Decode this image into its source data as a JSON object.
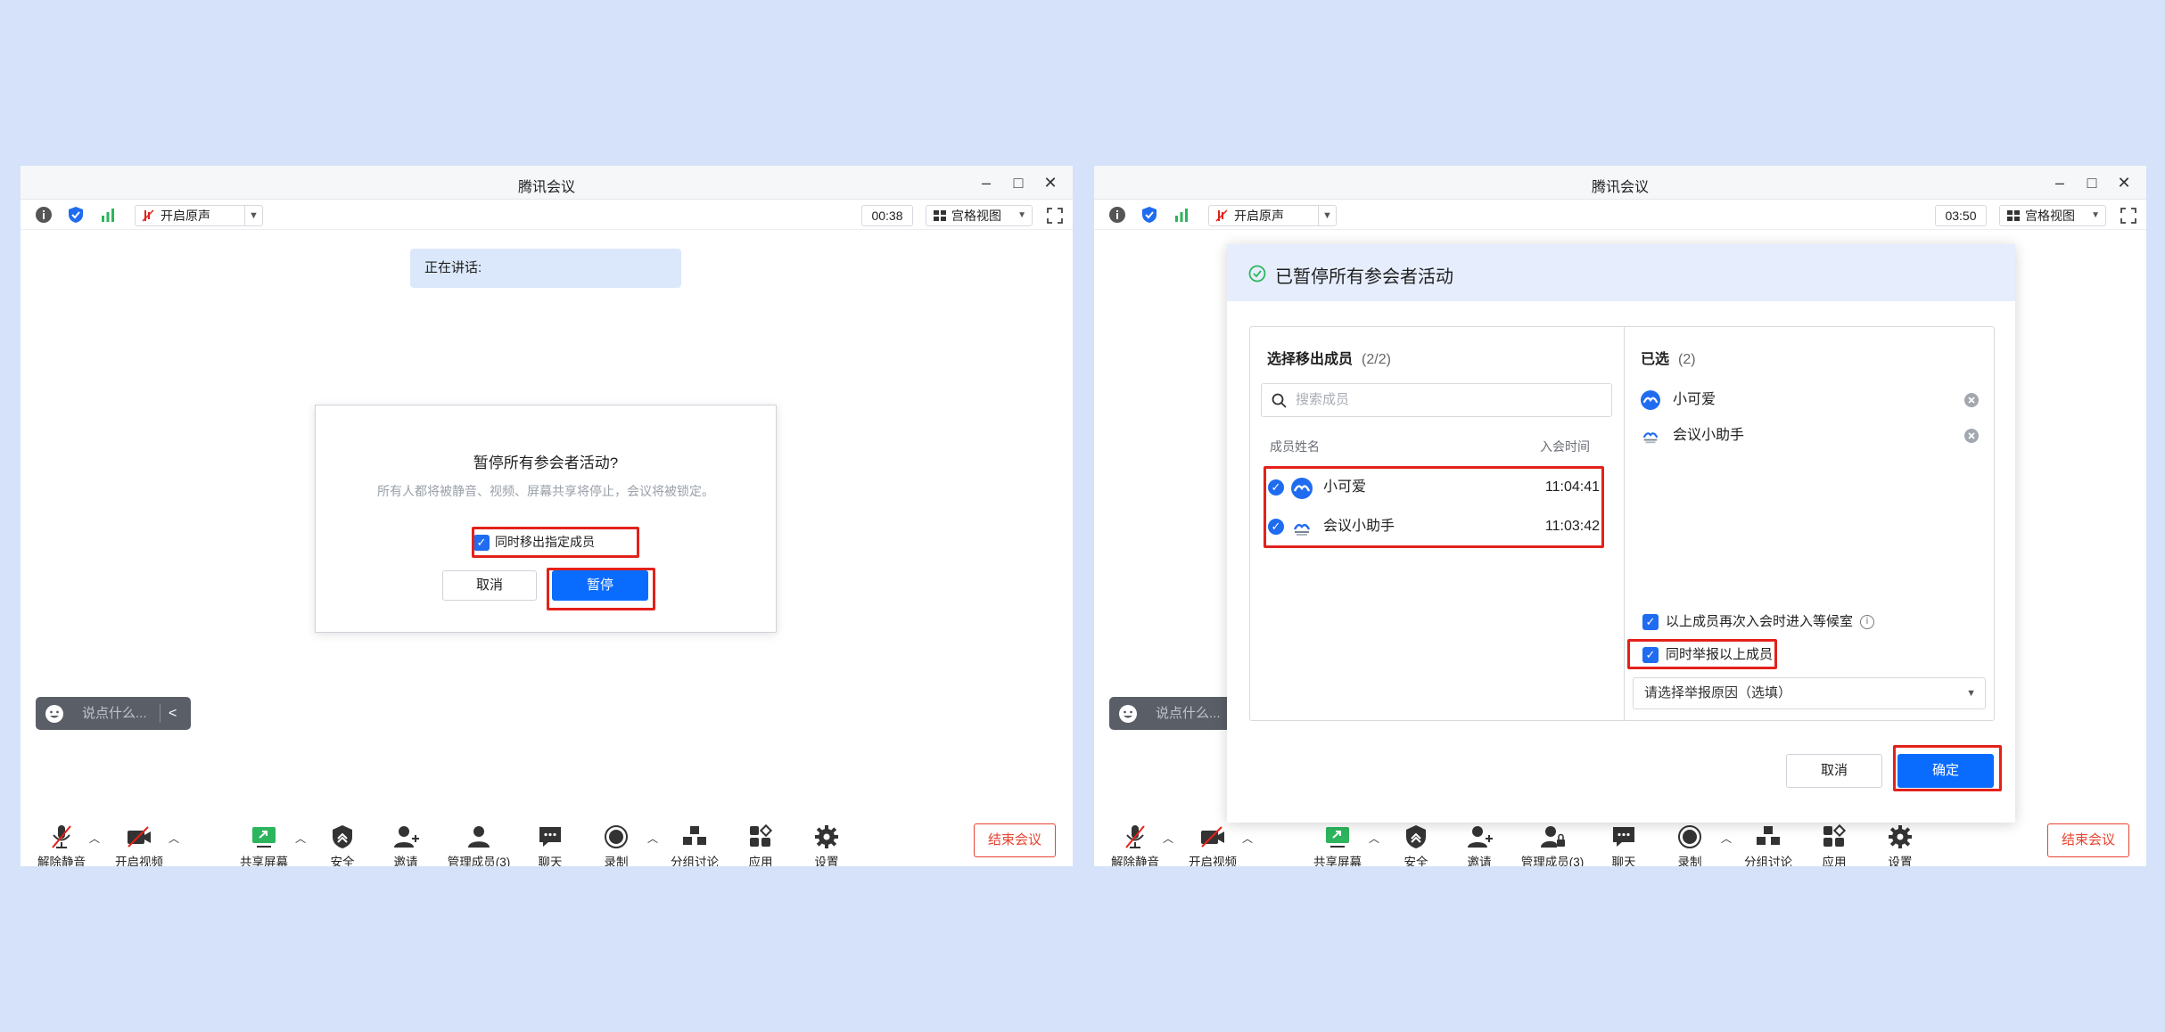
{
  "app": {
    "title": "腾讯会议"
  },
  "left": {
    "toolbar": {
      "original_sound": "开启原声",
      "timer": "00:38",
      "view": "宫格视图"
    },
    "speaking": "正在讲话:",
    "dialog": {
      "title": "暂停所有参会者活动?",
      "desc": "所有人都将被静音、视频、屏幕共享将停止，会议将被锁定。",
      "option": "同时移出指定成员",
      "cancel": "取消",
      "pause": "暂停"
    },
    "chat_placeholder": "说点什么..."
  },
  "right": {
    "toolbar": {
      "original_sound": "开启原声",
      "timer": "03:50",
      "view": "宫格视图"
    },
    "chat_placeholder": "说点什么...",
    "panel": {
      "title": "已暂停所有参会者活动",
      "remove_title": "选择移出成员",
      "remove_count": "(2/2)",
      "search_placeholder": "搜索成员",
      "col_name": "成员姓名",
      "col_time": "入会时间",
      "members": [
        {
          "name": "小可爱",
          "time": "11:04:41"
        },
        {
          "name": "会议小助手",
          "time": "11:03:42"
        }
      ],
      "selected_title": "已选",
      "selected_count": "(2)",
      "selected": [
        {
          "name": "小可爱"
        },
        {
          "name": "会议小助手"
        }
      ],
      "waiting_room_option": "以上成员再次入会时进入等候室",
      "report_option": "同时举报以上成员",
      "reason_placeholder": "请选择举报原因（选填）",
      "cancel": "取消",
      "confirm": "确定"
    }
  },
  "bottombar": {
    "unmute": "解除静音",
    "start_video": "开启视频",
    "share_screen": "共享屏幕",
    "security": "安全",
    "invite": "邀请",
    "manage_members": "管理成员(3)",
    "chat": "聊天",
    "record": "录制",
    "breakout": "分组讨论",
    "apps": "应用",
    "settings": "设置",
    "end_meeting": "结束会议"
  },
  "colors": {
    "accent": "#0a6cff",
    "highlight": "#e3211b",
    "danger": "#e6432f",
    "background": "#d6e2fa"
  }
}
